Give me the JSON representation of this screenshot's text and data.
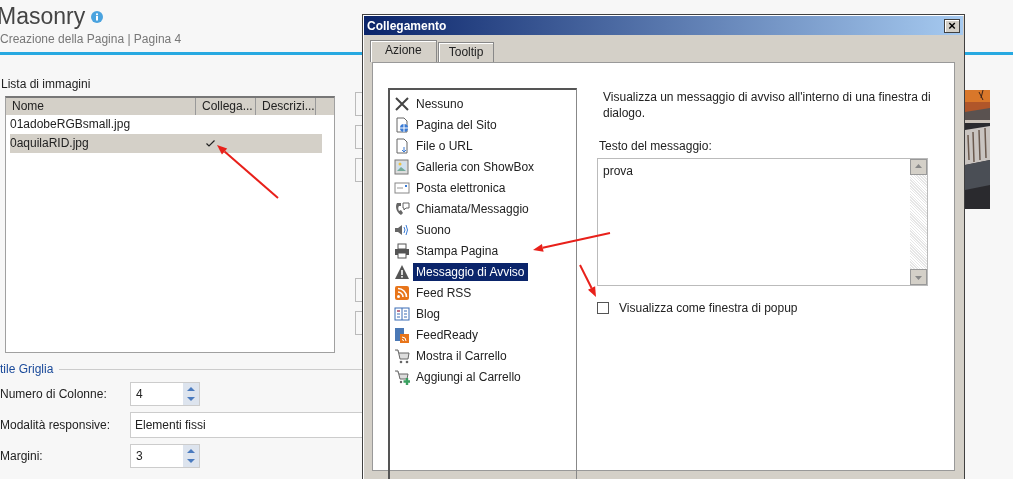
{
  "page": {
    "title": "Masonry",
    "subtitle": "Creazione della Pagina | Pagina 4",
    "images_label": "Lista di immagini",
    "table": {
      "columns": [
        "Nome",
        "Collega...",
        "Descrizi..."
      ],
      "rows": [
        {
          "name": "01adobeRGBsmall.jpg",
          "linked": false,
          "selected": false
        },
        {
          "name": "0aquilaRID.jpg",
          "linked": true,
          "selected": true
        }
      ]
    },
    "grid_section": {
      "title": "tile Griglia",
      "fields": [
        {
          "label": "Numero di Colonne:",
          "value": "4",
          "kind": "spinner"
        },
        {
          "label": "Modalità responsive:",
          "value": "Elementi fissi",
          "kind": "text"
        },
        {
          "label": "Margini:",
          "value": "3",
          "kind": "spinner"
        }
      ]
    }
  },
  "dialog": {
    "title": "Collegamento",
    "close": "×",
    "tabs": [
      {
        "label": "Azione",
        "selected": true
      },
      {
        "label": "Tooltip",
        "selected": false
      }
    ],
    "actions": [
      {
        "label": "Nessuno",
        "selected": false
      },
      {
        "label": "Pagina del Sito",
        "selected": false
      },
      {
        "label": "File o URL",
        "selected": false
      },
      {
        "label": "Galleria con ShowBox",
        "selected": false
      },
      {
        "label": "Posta elettronica",
        "selected": false
      },
      {
        "label": "Chiamata/Messaggio",
        "selected": false
      },
      {
        "label": "Suono",
        "selected": false
      },
      {
        "label": "Stampa Pagina",
        "selected": false
      },
      {
        "label": "Messaggio di Avviso",
        "selected": true
      },
      {
        "label": "Feed RSS",
        "selected": false
      },
      {
        "label": "Blog",
        "selected": false
      },
      {
        "label": "FeedReady",
        "selected": false
      },
      {
        "label": "Mostra il Carrello",
        "selected": false
      },
      {
        "label": "Aggiungi al Carrello",
        "selected": false
      }
    ],
    "description": "Visualizza un messaggio di avviso all'interno di una finestra di dialogo.",
    "message_label": "Testo del messaggio:",
    "message": "prova",
    "popup": {
      "label": "Visualizza come finestra di popup",
      "checked": false
    }
  }
}
